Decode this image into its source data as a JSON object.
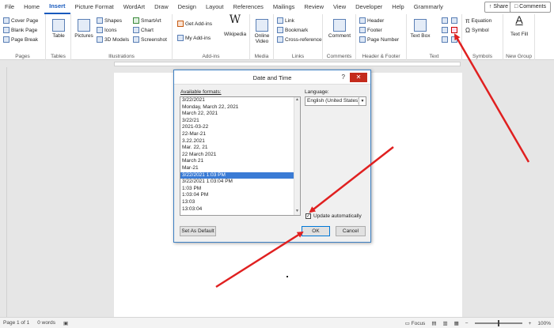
{
  "tabs": [
    "File",
    "Home",
    "Insert",
    "Picture Format",
    "WordArt",
    "Draw",
    "Design",
    "Layout",
    "References",
    "Mailings",
    "Review",
    "View",
    "Developer",
    "Help",
    "Grammarly"
  ],
  "active_tab": "Insert",
  "share_label": "Share",
  "comments_label": "Comments",
  "ribbon": {
    "pages": {
      "items": [
        "Cover Page",
        "Blank Page",
        "Page Break"
      ],
      "label": "Pages"
    },
    "tables": {
      "button": "Table",
      "label": "Tables"
    },
    "illustrations": {
      "pictures": "Pictures",
      "shapes": "Shapes",
      "icons": "Icons",
      "models": "3D Models",
      "smartart": "SmartArt",
      "chart": "Chart",
      "screenshot": "Screenshot",
      "label": "Illustrations"
    },
    "addins": {
      "get": "Get Add-ins",
      "my": "My Add-ins",
      "wikipedia": "Wikipedia",
      "label": "Add-ins"
    },
    "media": {
      "online_video": "Online Video",
      "label": "Media"
    },
    "links": {
      "link": "Link",
      "bookmark": "Bookmark",
      "crossref": "Cross-reference",
      "label": "Links"
    },
    "comments": {
      "comment": "Comment",
      "label": "Comments"
    },
    "header_footer": {
      "header": "Header",
      "footer": "Footer",
      "page_number": "Page Number",
      "label": "Header & Footer"
    },
    "text": {
      "text_box": "Text Box",
      "label": "Text"
    },
    "symbols": {
      "equation": "Equation",
      "symbol": "Symbol",
      "label": "Symbols"
    },
    "new_group": {
      "text_fill": "Text Fill",
      "label": "New Group"
    }
  },
  "dialog": {
    "title": "Date and Time",
    "help": "?",
    "close": "✕",
    "available_formats_label": "Available formats:",
    "formats": [
      "3/22/2021",
      "Monday, March 22, 2021",
      "March 22, 2021",
      "3/22/21",
      "2021-03-22",
      "22-Mar-21",
      "3.22.2021",
      "Mar. 22, 21",
      "22 March 2021",
      "March 21",
      "Mar-21",
      "3/22/2021 1:03 PM",
      "3/22/2021 1:03:04 PM",
      "1:03 PM",
      "1:03:04 PM",
      "13:03",
      "13:03:04"
    ],
    "selected_index": 11,
    "language_label": "Language:",
    "language_value": "English (United States)",
    "update_automatically_label": "Update automatically",
    "update_automatically_checked": true,
    "set_default_label": "Set As Default",
    "ok_label": "OK",
    "cancel_label": "Cancel"
  },
  "status": {
    "page": "Page 1 of 1",
    "words": "0 words",
    "focus": "Focus",
    "zoom": "100%"
  },
  "colors": {
    "accent": "#185abd",
    "arrow": "#e02020",
    "close": "#c42b1c",
    "selection": "#3a7bd5"
  }
}
